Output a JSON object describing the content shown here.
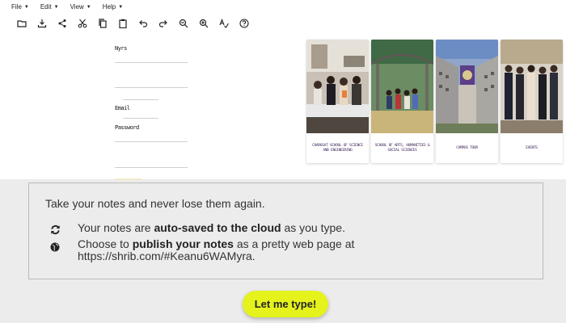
{
  "menu": [
    {
      "label": "File"
    },
    {
      "label": "Edit"
    },
    {
      "label": "View"
    },
    {
      "label": "Help"
    }
  ],
  "toolbar": [
    "folder-open-icon",
    "download-icon",
    "share-icon",
    "cut-icon",
    "copy-icon",
    "paste-icon",
    "undo-icon",
    "redo-icon",
    "zoom-out-icon",
    "zoom-in-icon",
    "spellcheck-icon",
    "help-icon"
  ],
  "form": {
    "name_label": "Nyrs",
    "email_label": "Email",
    "password_label": "Password"
  },
  "cards": [
    {
      "caption": "CHARUSAT SCHOOL OF SCIENCE AND ENGINEERING"
    },
    {
      "caption": "SCHOOL OF ARTS, HUMANITIES & SOCIAL SCIENCES"
    },
    {
      "caption": "CAMPUS TOUR"
    },
    {
      "caption": "EVENTS"
    }
  ],
  "info": {
    "tagline": "Take your notes and never lose them again.",
    "autosave_pre": "Your notes are ",
    "autosave_bold": "auto-saved to the cloud",
    "autosave_post": " as you type.",
    "publish_pre": "Choose to ",
    "publish_bold": "publish your notes",
    "publish_post": " as a pretty web page at",
    "publish_url": "https://shrib.com/#Keanu6WAMyra."
  },
  "cta_label": "Let me type!"
}
